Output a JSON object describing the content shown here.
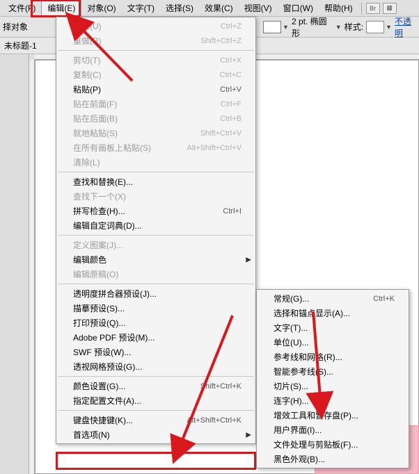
{
  "menubar": {
    "items": [
      {
        "label": "文件(F)"
      },
      {
        "label": "编辑(E)"
      },
      {
        "label": "对象(O)"
      },
      {
        "label": "文字(T)"
      },
      {
        "label": "选择(S)"
      },
      {
        "label": "效果(C)"
      },
      {
        "label": "视图(V)"
      },
      {
        "label": "窗口(W)"
      },
      {
        "label": "帮助(H)"
      }
    ],
    "br_icon": "Br"
  },
  "toolbar2": {
    "left_label": "择对象",
    "stroke_label": "2 pt. 椭圆形",
    "style_label": "样式:",
    "opacity_link": "不透明"
  },
  "doc_tab": {
    "label": "未标题-1"
  },
  "edit_menu": {
    "items": [
      {
        "label": "还原(U)",
        "shortcut": "Ctrl+Z",
        "disabled": true
      },
      {
        "label": "重做(R)",
        "shortcut": "Shift+Ctrl+Z",
        "disabled": true
      },
      {
        "sep": true
      },
      {
        "label": "剪切(T)",
        "shortcut": "Ctrl+X",
        "disabled": true
      },
      {
        "label": "复制(C)",
        "shortcut": "Ctrl+C",
        "disabled": true
      },
      {
        "label": "粘贴(P)",
        "shortcut": "Ctrl+V"
      },
      {
        "label": "贴在前面(F)",
        "shortcut": "Ctrl+F",
        "disabled": true
      },
      {
        "label": "贴在后面(B)",
        "shortcut": "Ctrl+B",
        "disabled": true
      },
      {
        "label": "就地粘贴(S)",
        "shortcut": "Shift+Ctrl+V",
        "disabled": true
      },
      {
        "label": "在所有画板上粘贴(S)",
        "shortcut": "Alt+Shift+Ctrl+V",
        "disabled": true
      },
      {
        "label": "清除(L)",
        "disabled": true
      },
      {
        "sep": true
      },
      {
        "label": "查找和替换(E)..."
      },
      {
        "label": "查找下一个(X)",
        "disabled": true
      },
      {
        "label": "拼写检查(H)...",
        "shortcut": "Ctrl+I"
      },
      {
        "label": "编辑自定词典(D)..."
      },
      {
        "sep": true
      },
      {
        "label": "定义图案(J)...",
        "disabled": true
      },
      {
        "label": "编辑颜色",
        "submenu": true
      },
      {
        "label": "编辑原稿(O)",
        "disabled": true
      },
      {
        "sep": true
      },
      {
        "label": "透明度拼合器预设(J)..."
      },
      {
        "label": "描摹预设(S)..."
      },
      {
        "label": "打印预设(Q)..."
      },
      {
        "label": "Adobe PDF 预设(M)..."
      },
      {
        "label": "SWF 预设(W)..."
      },
      {
        "label": "透视网格预设(G)..."
      },
      {
        "sep": true
      },
      {
        "label": "颜色设置(G)...",
        "shortcut": "Shift+Ctrl+K"
      },
      {
        "label": "指定配置文件(A)..."
      },
      {
        "sep": true
      },
      {
        "label": "键盘快捷键(K)...",
        "shortcut": "Alt+Shift+Ctrl+K"
      },
      {
        "label": "首选项(N)",
        "submenu": true
      }
    ]
  },
  "pref_submenu": {
    "items": [
      {
        "label": "常规(G)...",
        "shortcut": "Ctrl+K"
      },
      {
        "label": "选择和锚点显示(A)..."
      },
      {
        "label": "文字(T)..."
      },
      {
        "label": "单位(U)..."
      },
      {
        "label": "参考线和网格(R)..."
      },
      {
        "label": "智能参考线(S)..."
      },
      {
        "label": "切片(S)..."
      },
      {
        "label": "连字(H)..."
      },
      {
        "label": "增效工具和暂存盘(P)..."
      },
      {
        "label": "用户界面(I)..."
      },
      {
        "label": "文件处理与剪贴板(F)..."
      },
      {
        "label": "黑色外观(B)..."
      }
    ]
  }
}
